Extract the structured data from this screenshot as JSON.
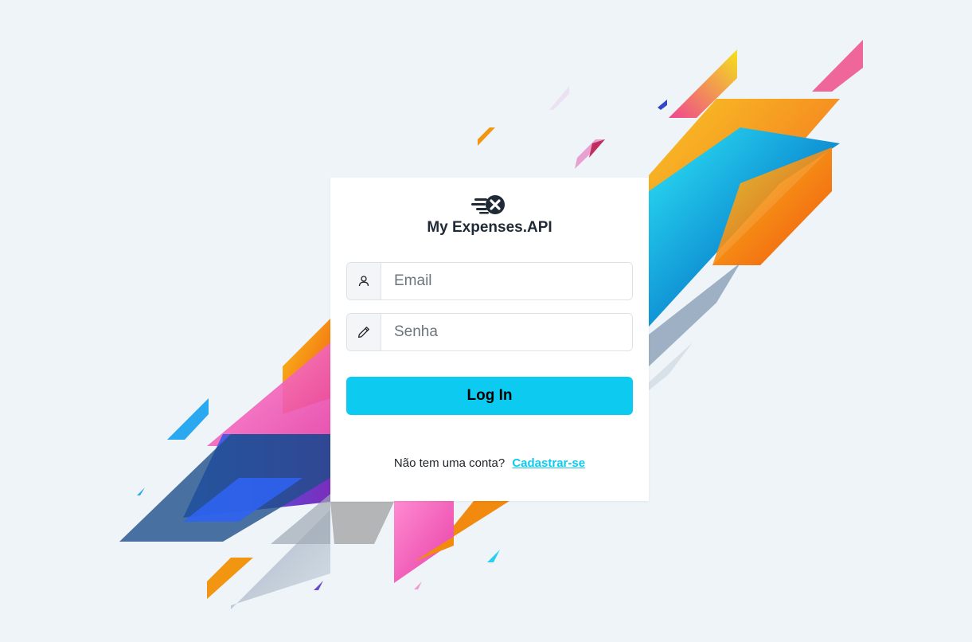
{
  "app": {
    "title": "My Expenses.API",
    "logo_icon": "flying-x-logo-icon"
  },
  "form": {
    "email": {
      "placeholder": "Email",
      "value": "",
      "icon": "user-icon"
    },
    "password": {
      "placeholder": "Senha",
      "value": "",
      "icon": "pencil-icon"
    },
    "login_label": "Log In"
  },
  "signup": {
    "prompt": "Não tem uma conta?",
    "link_label": "Cadastrar-se"
  },
  "colors": {
    "accent": "#0dcaf0",
    "background": "#eff4f8",
    "card": "#ffffff",
    "title_text": "#1f2a36"
  }
}
